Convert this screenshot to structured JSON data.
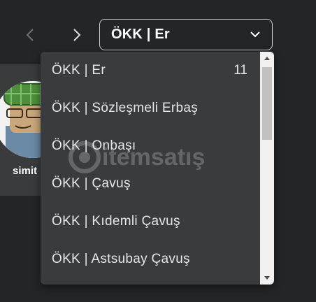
{
  "navigation": {
    "prev_icon": "chevron-left-icon",
    "next_icon": "chevron-right-icon"
  },
  "group_select": {
    "selected": "ÖKK | Er",
    "icon": "chevron-down-icon"
  },
  "member_card": {
    "name": "simit"
  },
  "rank_options": [
    {
      "label": "ÖKK | Er",
      "count": "11"
    },
    {
      "label": "ÖKK | Sözleşmeli Erbaş",
      "count": ""
    },
    {
      "label": "ÖKK | Onbaşı",
      "count": ""
    },
    {
      "label": "ÖKK | Çavuş",
      "count": ""
    },
    {
      "label": "ÖKK | Kıdemli Çavuş",
      "count": ""
    },
    {
      "label": "ÖKK | Astsubay Çavuş",
      "count": ""
    }
  ],
  "watermark": {
    "text": "itemsatış"
  },
  "colors": {
    "background": "#232527",
    "dropdown": "#393b3d",
    "text": "#e6e6e6",
    "border": "#cfd0d1"
  }
}
